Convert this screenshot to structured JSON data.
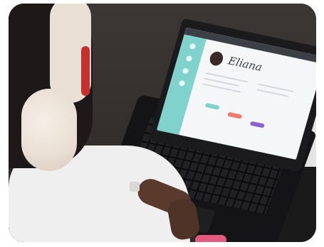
{
  "photo": {
    "screen_name": "Eliana"
  }
}
